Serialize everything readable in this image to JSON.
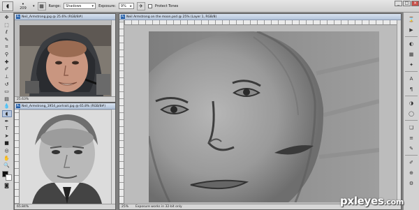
{
  "options_bar": {
    "brush_size": "209",
    "range_label": "Range:",
    "range_value": "Shadows",
    "exposure_label": "Exposure:",
    "exposure_value": "9%",
    "protect_tones_label": "Protect Tones"
  },
  "doc1": {
    "title": "Neil_Armstrong.jpg @ 25.6% (RGB/8#)",
    "zoom": "25.63%"
  },
  "doc2": {
    "title": "Neil_Armstrong_1954_portrait.jpg @ 65.8% (RGB/8#)",
    "zoom": "65.84%"
  },
  "doc3": {
    "title": "Neil Armstrong on the moon.psd @ 25% (Layer 1, RGB/8)",
    "zoom": "25%",
    "status": "Exposure works in 32-bit only"
  },
  "watermark": {
    "main": "pxleyes",
    "suffix": ".com"
  },
  "icons": [
    "sponge-burn-tool-icon",
    "move-tool-icon",
    "marquee-tool-icon",
    "lasso-tool-icon",
    "quick-select-icon",
    "crop-tool-icon",
    "eyedropper-icon",
    "healing-brush-icon",
    "brush-tool-icon",
    "clone-stamp-icon",
    "history-brush-icon",
    "eraser-icon",
    "gradient-icon",
    "blur-icon",
    "dodge-tool-icon",
    "pen-tool-icon",
    "type-tool-icon",
    "path-select-icon",
    "shape-tool-icon",
    "hand-tool-icon",
    "zoom-tool-icon"
  ]
}
